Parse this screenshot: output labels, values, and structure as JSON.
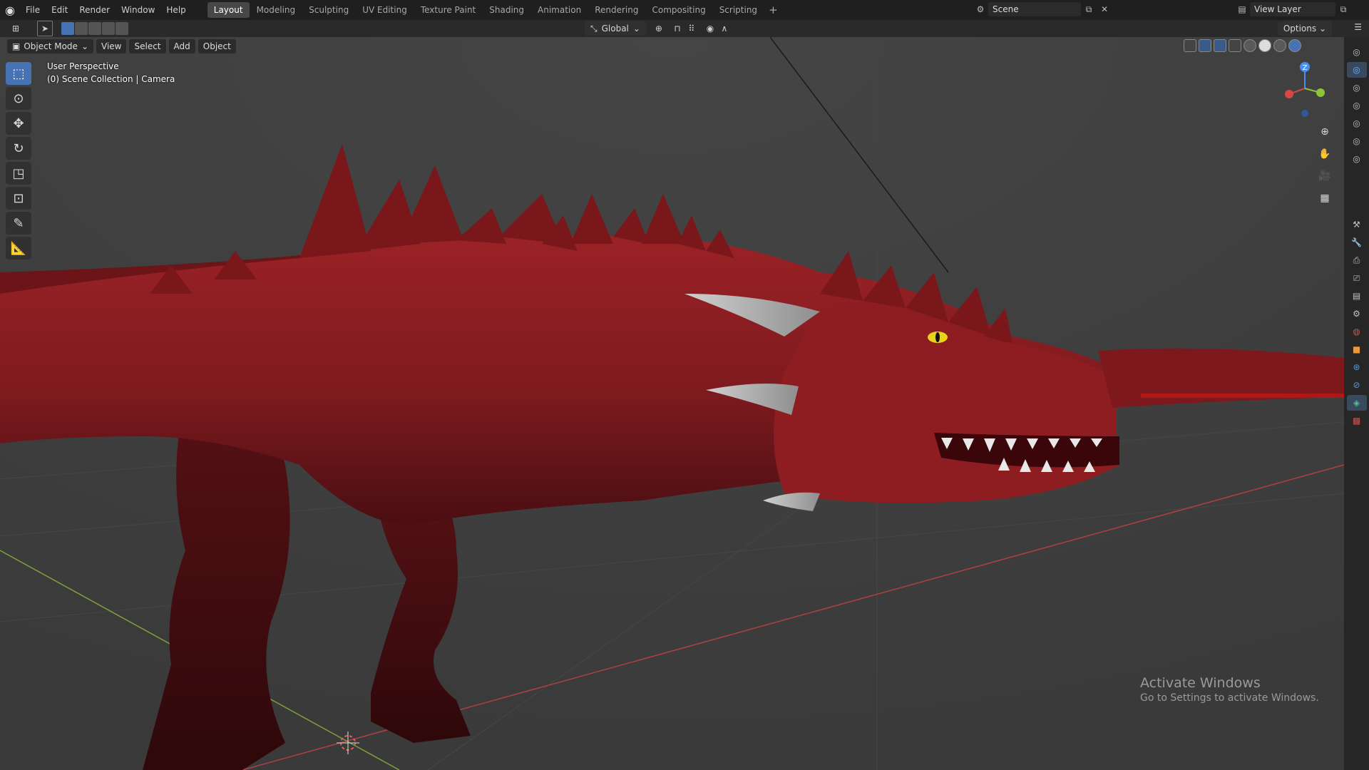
{
  "menu": [
    "File",
    "Edit",
    "Render",
    "Window",
    "Help"
  ],
  "workspaces": [
    "Layout",
    "Modeling",
    "Sculpting",
    "UV Editing",
    "Texture Paint",
    "Shading",
    "Animation",
    "Rendering",
    "Compositing",
    "Scripting"
  ],
  "active_workspace": "Layout",
  "scene_name": "Scene",
  "view_layer": "View Layer",
  "header": {
    "mode": "Object Mode",
    "view": "View",
    "select": "Select",
    "add": "Add",
    "object": "Object",
    "orientation": "Global",
    "options": "Options"
  },
  "viewport": {
    "perspective": "User Perspective",
    "collection": "(0) Scene Collection | Camera"
  },
  "gizmo": {
    "z_label": "Z"
  },
  "watermark": {
    "title": "Activate Windows",
    "subtitle": "Go to Settings to activate Windows."
  },
  "colors": {
    "accent": "#4772b3",
    "dragon": "#8a1a1f",
    "x_axis": "#d64848",
    "y_axis": "#8dc43a",
    "z_axis": "#4a8ef0"
  }
}
